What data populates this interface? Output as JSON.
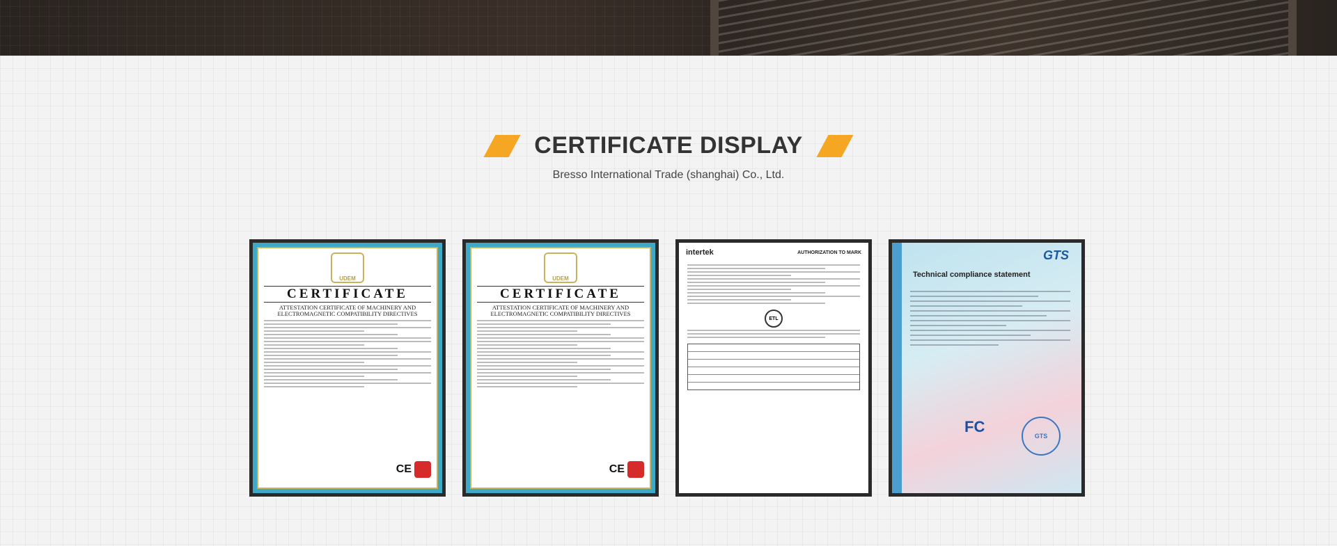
{
  "section": {
    "title": "CERTIFICATE DISPLAY",
    "subtitle": "Bresso International Trade (shanghai) Co., Ltd."
  },
  "certificates": [
    {
      "heading": "CERTIFICATE",
      "badge": "UDEM",
      "subheading": "ATTESTATION CERTIFICATE OF MACHINERY AND ELECTROMAGNETIC COMPATIBILITY DIRECTIVES",
      "mark": "CE"
    },
    {
      "heading": "CERTIFICATE",
      "badge": "UDEM",
      "subheading": "ATTESTATION CERTIFICATE OF MACHINERY AND ELECTROMAGNETIC COMPATIBILITY DIRECTIVES",
      "mark": "CE"
    },
    {
      "logo": "intertek",
      "heading": "AUTHORIZATION TO MARK",
      "mark": "ETL"
    },
    {
      "logo": "GTS",
      "heading": "Technical compliance statement",
      "mark": "FC",
      "seal": "GTS"
    }
  ],
  "colors": {
    "accent": "#f5a623",
    "cert_frame": "#2a2a2a",
    "cert_blue": "#3ea9c7"
  }
}
